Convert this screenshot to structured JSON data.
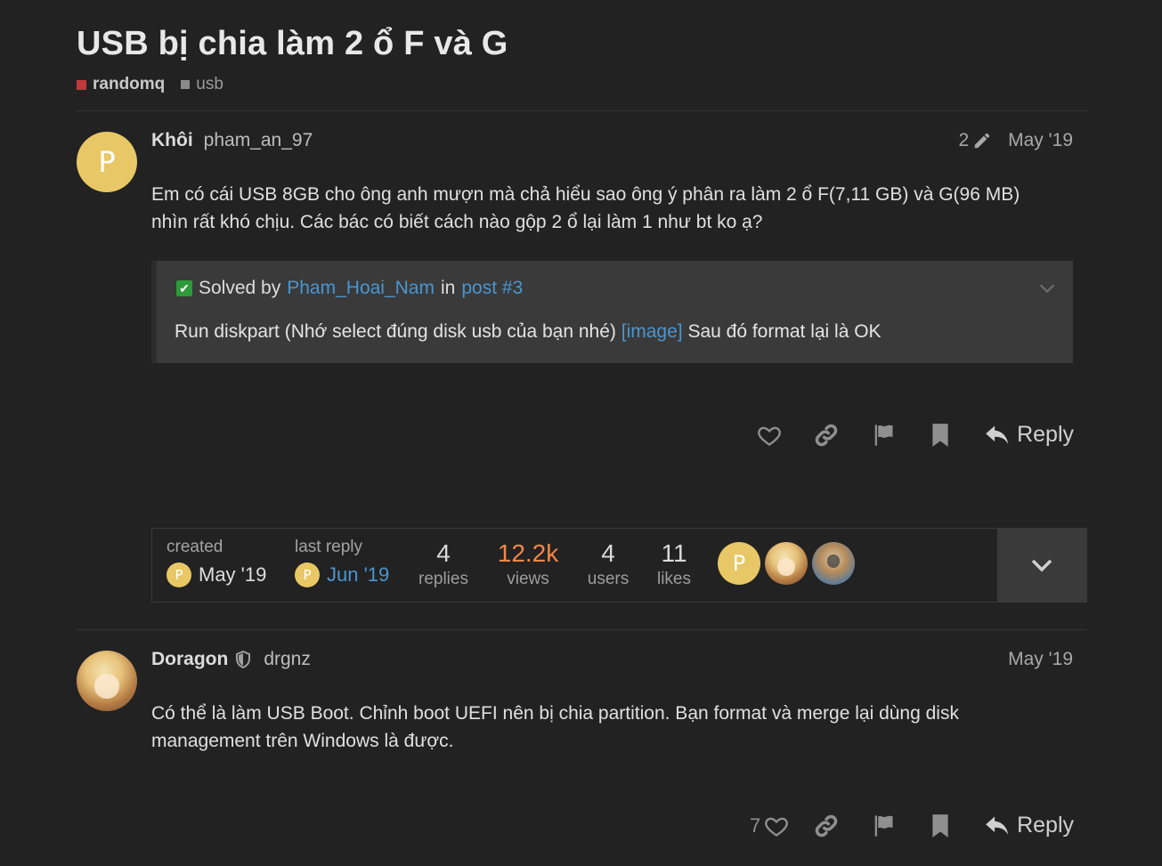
{
  "topic": {
    "title": "USB bị chia làm 2 ổ F và G",
    "category": "randomq",
    "tag": "usb",
    "category_color": "#c0393b"
  },
  "post1": {
    "avatar_letter": "P",
    "username": "Khôi",
    "handle": "pham_an_97",
    "edit_count": "2",
    "date": "May '19",
    "body": "Em có cái USB 8GB cho ông anh mượn mà chả hiểu sao ông ý phân ra làm 2 ổ F(7,11 GB) và G(96 MB) nhìn rất khó chịu. Các bác có biết cách nào gộp 2 ổ lại làm 1 như bt ko ạ?",
    "solved": {
      "prefix": "Solved by",
      "user": "Pham_Hoai_Nam",
      "in": "in",
      "post_link": "post #3",
      "text_before": "Run diskpart (Nhớ select đúng disk usb của bạn nhé)",
      "image_link": "[image]",
      "text_after": "Sau đó format lại là OK"
    },
    "reply_label": "Reply"
  },
  "topic_map": {
    "created_label": "created",
    "created_date": "May '19",
    "last_reply_label": "last reply",
    "last_reply_date": "Jun '19",
    "mini_avatar_letter": "P",
    "replies": "4",
    "replies_label": "replies",
    "views": "12.2k",
    "views_label": "views",
    "users": "4",
    "users_label": "users",
    "likes": "11",
    "likes_label": "likes",
    "participant_letter": "P"
  },
  "post2": {
    "username": "Doragon",
    "handle": "drgnz",
    "date": "May '19",
    "body": "Có thể là làm USB Boot. Chỉnh boot UEFI nên bị chia partition. Bạn format và merge lại dùng disk management trên Windows là được.",
    "like_count": "7",
    "reply_label": "Reply"
  },
  "icons": {
    "like": "heart-icon",
    "share": "link-icon",
    "flag": "flag-icon",
    "bookmark": "bookmark-icon",
    "reply": "reply-icon",
    "edit": "pencil-icon",
    "moderator": "shield-icon",
    "expand": "chevron-down-icon"
  }
}
